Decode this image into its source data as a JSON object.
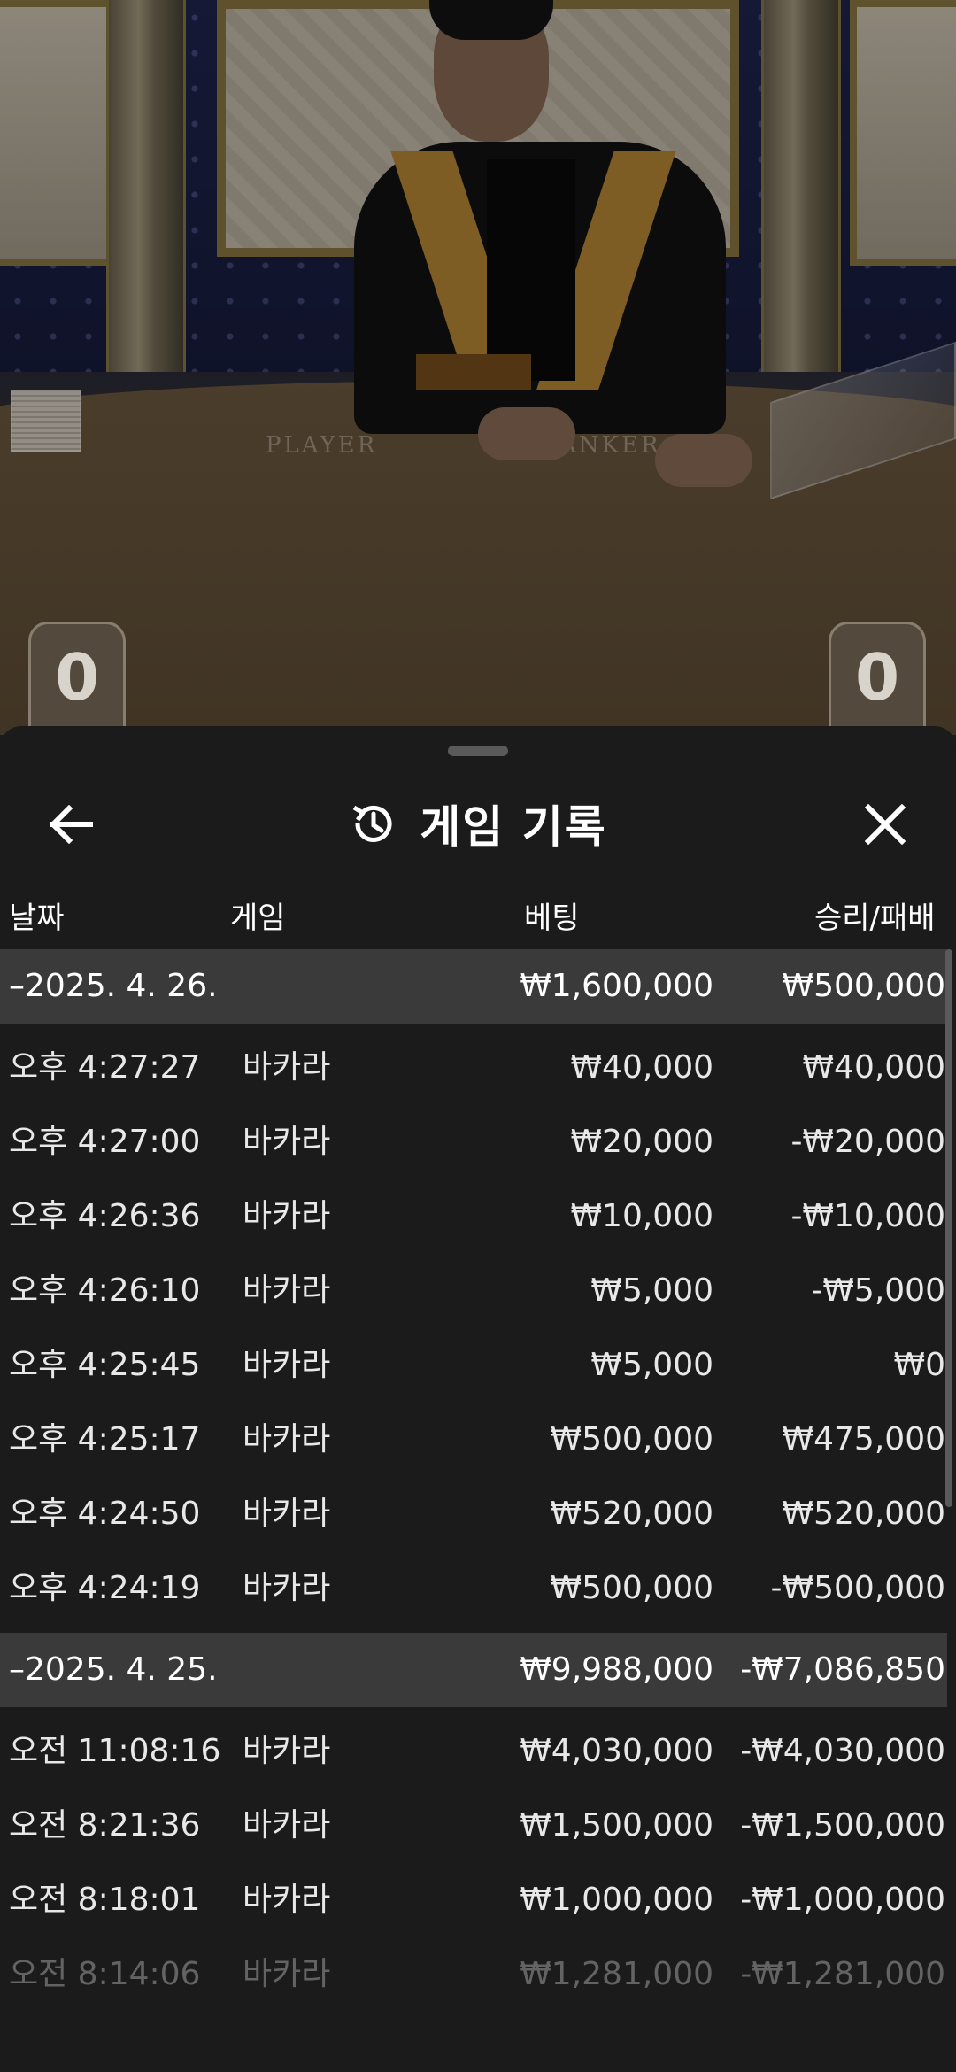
{
  "video": {
    "table_player_label": "PLAYER",
    "table_banker_label": "BANKER",
    "player_score": "0",
    "banker_score": "0"
  },
  "sheet": {
    "title": "게임 기록",
    "icons": {
      "back": "arrow-left-icon",
      "history": "history-icon",
      "close": "close-icon"
    }
  },
  "columns": {
    "date": "날짜",
    "game": "게임",
    "bet": "베팅",
    "result": "승리/패배"
  },
  "groups": [
    {
      "date": "–2025. 4. 26.",
      "total_bet": "₩1,600,000",
      "total_result": "₩500,000",
      "rows": [
        {
          "time": "오후 4:27:27",
          "game": "바카라",
          "bet": "₩40,000",
          "result": "₩40,000"
        },
        {
          "time": "오후 4:27:00",
          "game": "바카라",
          "bet": "₩20,000",
          "result": "-₩20,000"
        },
        {
          "time": "오후 4:26:36",
          "game": "바카라",
          "bet": "₩10,000",
          "result": "-₩10,000"
        },
        {
          "time": "오후 4:26:10",
          "game": "바카라",
          "bet": "₩5,000",
          "result": "-₩5,000"
        },
        {
          "time": "오후 4:25:45",
          "game": "바카라",
          "bet": "₩5,000",
          "result": "₩0"
        },
        {
          "time": "오후 4:25:17",
          "game": "바카라",
          "bet": "₩500,000",
          "result": "₩475,000"
        },
        {
          "time": "오후 4:24:50",
          "game": "바카라",
          "bet": "₩520,000",
          "result": "₩520,000"
        },
        {
          "time": "오후 4:24:19",
          "game": "바카라",
          "bet": "₩500,000",
          "result": "-₩500,000"
        }
      ]
    },
    {
      "date": "–2025. 4. 25.",
      "total_bet": "₩9,988,000",
      "total_result": "-₩7,086,850",
      "rows": [
        {
          "time": "오전 11:08:16",
          "game": "바카라",
          "bet": "₩4,030,000",
          "result": "-₩4,030,000"
        },
        {
          "time": "오전 8:21:36",
          "game": "바카라",
          "bet": "₩1,500,000",
          "result": "-₩1,500,000"
        },
        {
          "time": "오전 8:18:01",
          "game": "바카라",
          "bet": "₩1,000,000",
          "result": "-₩1,000,000"
        },
        {
          "time": "오전 8:14:06",
          "game": "바카라",
          "bet": "₩1,281,000",
          "result": "-₩1,281,000"
        }
      ]
    }
  ]
}
